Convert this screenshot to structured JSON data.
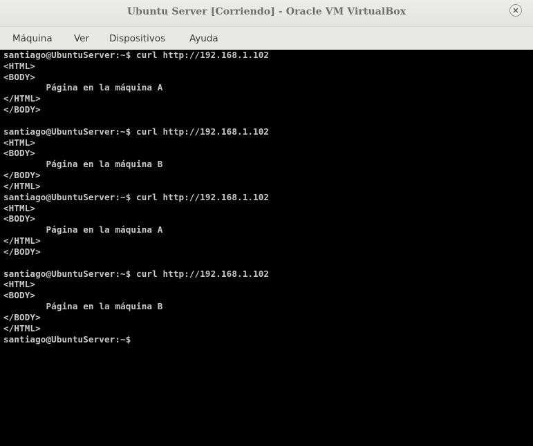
{
  "window": {
    "title": "Ubuntu Server [Corriendo] - Oracle VM VirtualBox",
    "close_icon": "close-icon"
  },
  "menubar": {
    "items": [
      "Máquina",
      "Ver",
      "Dispositivos",
      "Ayuda"
    ]
  },
  "terminal": {
    "lines": [
      "santiago@UbuntuServer:~$ curl http://192.168.1.102",
      "<HTML>",
      "<BODY>",
      "        Página en la máquina A",
      "</HTML>",
      "</BODY>",
      "",
      "santiago@UbuntuServer:~$ curl http://192.168.1.102",
      "<HTML>",
      "<BODY>",
      "        Página en la máquina B",
      "</BODY>",
      "</HTML>",
      "santiago@UbuntuServer:~$ curl http://192.168.1.102",
      "<HTML>",
      "<BODY>",
      "        Página en la máquina A",
      "</HTML>",
      "</BODY>",
      "",
      "santiago@UbuntuServer:~$ curl http://192.168.1.102",
      "<HTML>",
      "<BODY>",
      "        Página en la máquina B",
      "</BODY>",
      "</HTML>",
      "santiago@UbuntuServer:~$"
    ]
  }
}
